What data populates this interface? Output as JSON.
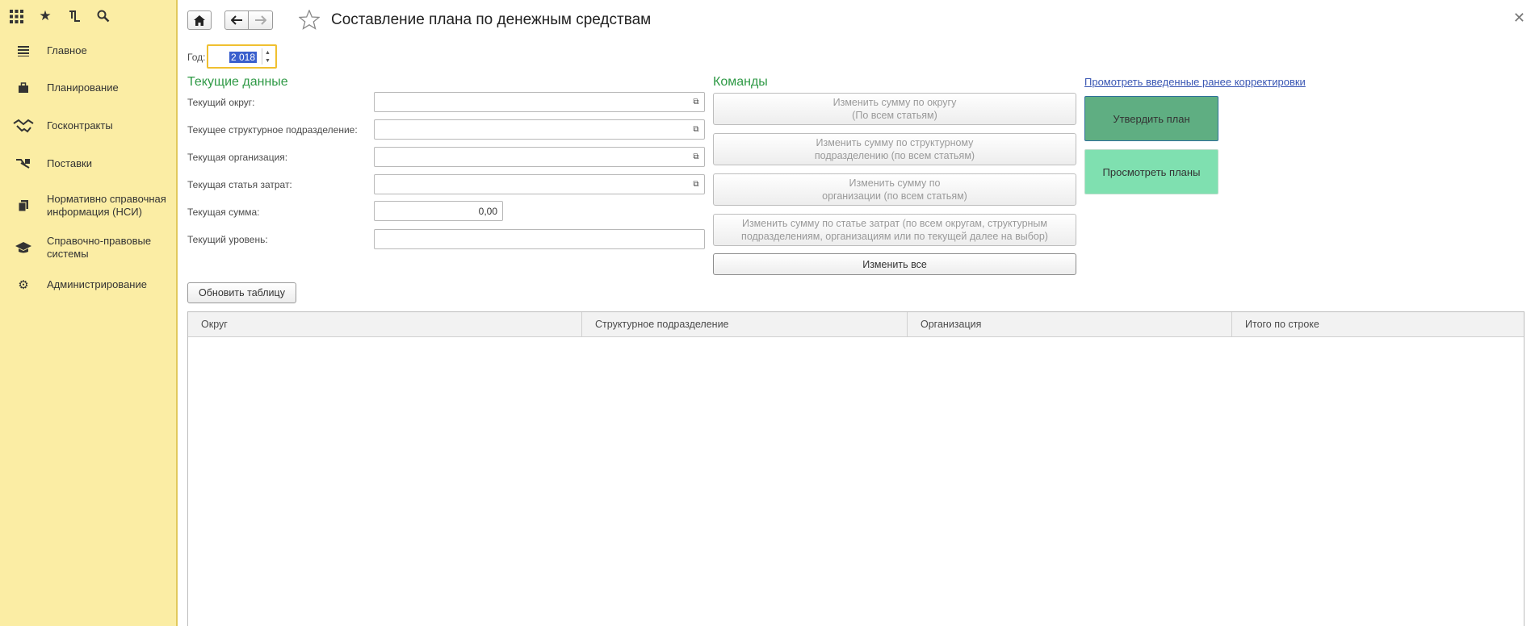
{
  "sidebar": {
    "top_icons": [
      "apps-grid-icon",
      "star-icon",
      "history-icon",
      "search-icon"
    ],
    "items": [
      {
        "label": "Главное",
        "icon": "menu-lines-icon"
      },
      {
        "label": "Планирование",
        "icon": "briefcase-icon"
      },
      {
        "label": "Госконтракты",
        "icon": "handshake-icon"
      },
      {
        "label": "Поставки",
        "icon": "delivery-icon"
      },
      {
        "label": "Нормативно справочная информация (НСИ)",
        "icon": "documents-icon"
      },
      {
        "label": "Справочно-правовые системы",
        "icon": "graduation-cap-icon"
      },
      {
        "label": "Администрирование",
        "icon": "gear-icon"
      }
    ]
  },
  "header": {
    "title": "Составление плана по денежным средствам"
  },
  "form": {
    "year_label": "Год:",
    "year_value": "2 018",
    "current_data_title": "Текущие данные",
    "fields": [
      {
        "label": "Текущий округ:",
        "value": ""
      },
      {
        "label": "Текущее структурное подразделение:",
        "value": ""
      },
      {
        "label": "Текущая организация:",
        "value": ""
      },
      {
        "label": "Текущая статья затрат:",
        "value": ""
      },
      {
        "label": "Текущая сумма:",
        "value": "0,00"
      },
      {
        "label": "Текущий уровень:",
        "value": ""
      }
    ]
  },
  "commands": {
    "title": "Команды",
    "buttons": [
      {
        "line1": "Изменить сумму по округу",
        "line2": "(По всем статьям)"
      },
      {
        "line1": "Изменить сумму по структурному",
        "line2": "подразделению (по всем статьям)"
      },
      {
        "line1": "Изменить сумму по",
        "line2": "организации (по всем статьям)"
      },
      {
        "line1": "Изменить сумму по статье затрат (по всем округам, структурным",
        "line2": "подразделениям, организациям или по текущей далее на выбор)"
      },
      {
        "line1": "Изменить все",
        "line2": ""
      }
    ]
  },
  "actions": {
    "link": "Промотреть введенные ранее корректировки",
    "approve": "Утвердить план",
    "view": "Просмотреть планы",
    "approve_color": "#5fae82",
    "view_color": "#7fe0b0"
  },
  "refresh_button": "Обновить таблицу",
  "table": {
    "columns": [
      "Округ",
      "Структурное подразделение",
      "Организация",
      "Итого по строке"
    ]
  }
}
